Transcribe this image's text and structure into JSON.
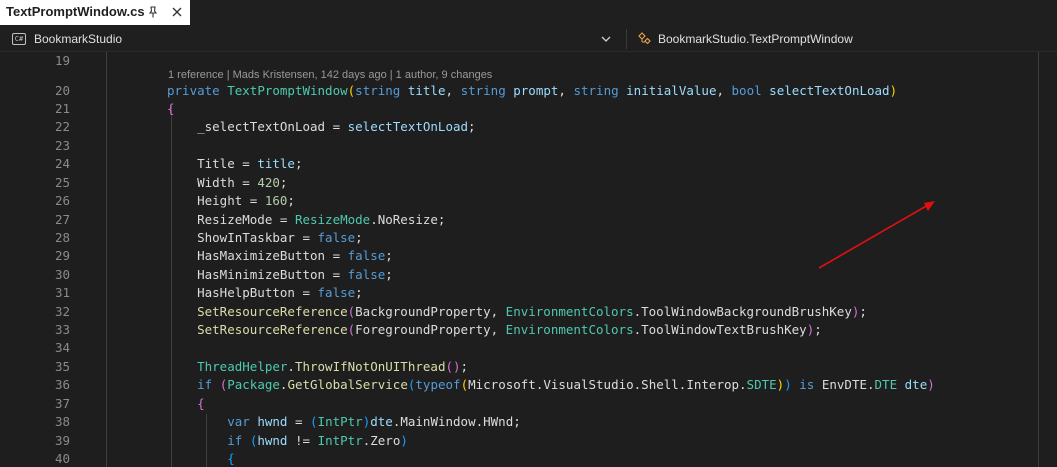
{
  "tab": {
    "title": "TextPromptWindow.cs"
  },
  "nav": {
    "project": "BookmarkStudio",
    "member": "BookmarkStudio.TextPromptWindow"
  },
  "codelens": {
    "text": "1 reference | Mads Kristensen, 142 days ago | 1 author, 9 changes"
  },
  "editor": {
    "lines": [
      {
        "num": "19",
        "tokens": []
      },
      {
        "num": "20",
        "tokens": [
          {
            "t": "private",
            "c": "kw"
          },
          {
            "t": " "
          },
          {
            "t": "TextPromptWindow",
            "c": "ty"
          },
          {
            "t": "(",
            "c": "b1"
          },
          {
            "t": "string",
            "c": "kw"
          },
          {
            "t": " "
          },
          {
            "t": "title",
            "c": "pm"
          },
          {
            "t": ", "
          },
          {
            "t": "string",
            "c": "kw"
          },
          {
            "t": " "
          },
          {
            "t": "prompt",
            "c": "pm"
          },
          {
            "t": ", "
          },
          {
            "t": "string",
            "c": "kw"
          },
          {
            "t": " "
          },
          {
            "t": "initialValue",
            "c": "pm"
          },
          {
            "t": ", "
          },
          {
            "t": "bool",
            "c": "kw"
          },
          {
            "t": " "
          },
          {
            "t": "selectTextOnLoad",
            "c": "pm"
          },
          {
            "t": ")",
            "c": "b1"
          }
        ]
      },
      {
        "num": "21",
        "tokens": [
          {
            "t": "{",
            "c": "b2"
          }
        ]
      },
      {
        "num": "22",
        "tokens": [
          {
            "t": "    "
          },
          {
            "t": "_selectTextOnLoad",
            "c": "fd"
          },
          {
            "t": " = "
          },
          {
            "t": "selectTextOnLoad",
            "c": "pm"
          },
          {
            "t": ";"
          }
        ]
      },
      {
        "num": "23",
        "tokens": []
      },
      {
        "num": "24",
        "tokens": [
          {
            "t": "    Title = "
          },
          {
            "t": "title",
            "c": "pm"
          },
          {
            "t": ";"
          }
        ]
      },
      {
        "num": "25",
        "tokens": [
          {
            "t": "    Width = "
          },
          {
            "t": "420",
            "c": "nm"
          },
          {
            "t": ";"
          }
        ]
      },
      {
        "num": "26",
        "tokens": [
          {
            "t": "    Height = "
          },
          {
            "t": "160",
            "c": "nm"
          },
          {
            "t": ";"
          }
        ]
      },
      {
        "num": "27",
        "tokens": [
          {
            "t": "    ResizeMode = "
          },
          {
            "t": "ResizeMode",
            "c": "ty"
          },
          {
            "t": ".NoResize;"
          }
        ]
      },
      {
        "num": "28",
        "tokens": [
          {
            "t": "    ShowInTaskbar = "
          },
          {
            "t": "false",
            "c": "kw"
          },
          {
            "t": ";"
          }
        ]
      },
      {
        "num": "29",
        "tokens": [
          {
            "t": "    HasMaximizeButton = "
          },
          {
            "t": "false",
            "c": "kw"
          },
          {
            "t": ";"
          }
        ]
      },
      {
        "num": "30",
        "tokens": [
          {
            "t": "    HasMinimizeButton = "
          },
          {
            "t": "false",
            "c": "kw"
          },
          {
            "t": ";"
          }
        ]
      },
      {
        "num": "31",
        "tokens": [
          {
            "t": "    HasHelpButton = "
          },
          {
            "t": "false",
            "c": "kw"
          },
          {
            "t": ";"
          }
        ]
      },
      {
        "num": "32",
        "tokens": [
          {
            "t": "    "
          },
          {
            "t": "SetResourceReference",
            "c": "mt"
          },
          {
            "t": "(",
            "c": "b2"
          },
          {
            "t": "BackgroundProperty, "
          },
          {
            "t": "EnvironmentColors",
            "c": "ty"
          },
          {
            "t": ".ToolWindowBackgroundBrushKey"
          },
          {
            "t": ")",
            "c": "b2"
          },
          {
            "t": ";"
          }
        ]
      },
      {
        "num": "33",
        "tokens": [
          {
            "t": "    "
          },
          {
            "t": "SetResourceReference",
            "c": "mt"
          },
          {
            "t": "(",
            "c": "b2"
          },
          {
            "t": "ForegroundProperty, "
          },
          {
            "t": "EnvironmentColors",
            "c": "ty"
          },
          {
            "t": ".ToolWindowTextBrushKey"
          },
          {
            "t": ")",
            "c": "b2"
          },
          {
            "t": ";"
          }
        ]
      },
      {
        "num": "34",
        "tokens": []
      },
      {
        "num": "35",
        "tokens": [
          {
            "t": "    "
          },
          {
            "t": "ThreadHelper",
            "c": "ty"
          },
          {
            "t": "."
          },
          {
            "t": "ThrowIfNotOnUIThread",
            "c": "mt"
          },
          {
            "t": "(",
            "c": "b2"
          },
          {
            "t": ")",
            "c": "b2"
          },
          {
            "t": ";"
          }
        ]
      },
      {
        "num": "36",
        "tokens": [
          {
            "t": "    "
          },
          {
            "t": "if",
            "c": "kw"
          },
          {
            "t": " "
          },
          {
            "t": "(",
            "c": "b2"
          },
          {
            "t": "Package",
            "c": "ty"
          },
          {
            "t": "."
          },
          {
            "t": "GetGlobalService",
            "c": "mt"
          },
          {
            "t": "(",
            "c": "b3"
          },
          {
            "t": "typeof",
            "c": "kw"
          },
          {
            "t": "(",
            "c": "b1"
          },
          {
            "t": "Microsoft.VisualStudio.Shell.Interop."
          },
          {
            "t": "SDTE",
            "c": "ty"
          },
          {
            "t": ")",
            "c": "b1"
          },
          {
            "t": ")",
            "c": "b3"
          },
          {
            "t": " "
          },
          {
            "t": "is",
            "c": "kw"
          },
          {
            "t": " EnvDTE."
          },
          {
            "t": "DTE",
            "c": "ty"
          },
          {
            "t": " "
          },
          {
            "t": "dte",
            "c": "lv"
          },
          {
            "t": ")",
            "c": "b2"
          }
        ]
      },
      {
        "num": "37",
        "tokens": [
          {
            "t": "    "
          },
          {
            "t": "{",
            "c": "b2"
          }
        ]
      },
      {
        "num": "38",
        "tokens": [
          {
            "t": "        "
          },
          {
            "t": "var",
            "c": "kw"
          },
          {
            "t": " "
          },
          {
            "t": "hwnd",
            "c": "lv"
          },
          {
            "t": " = "
          },
          {
            "t": "(",
            "c": "b3"
          },
          {
            "t": "IntPtr",
            "c": "ty"
          },
          {
            "t": ")",
            "c": "b3"
          },
          {
            "t": "dte",
            "c": "lv"
          },
          {
            "t": ".MainWindow.HWnd;"
          }
        ]
      },
      {
        "num": "39",
        "tokens": [
          {
            "t": "        "
          },
          {
            "t": "if",
            "c": "kw"
          },
          {
            "t": " "
          },
          {
            "t": "(",
            "c": "b3"
          },
          {
            "t": "hwnd",
            "c": "lv"
          },
          {
            "t": " != "
          },
          {
            "t": "IntPtr",
            "c": "ty"
          },
          {
            "t": ".Zero"
          },
          {
            "t": ")",
            "c": "b3"
          }
        ]
      },
      {
        "num": "40",
        "tokens": [
          {
            "t": "        "
          },
          {
            "t": "{",
            "c": "b3"
          }
        ]
      }
    ]
  },
  "colors": {
    "editor_bg": "#1e1e1e",
    "annotation_arrow": "#e01010",
    "tab_bg": "#ffffff"
  }
}
